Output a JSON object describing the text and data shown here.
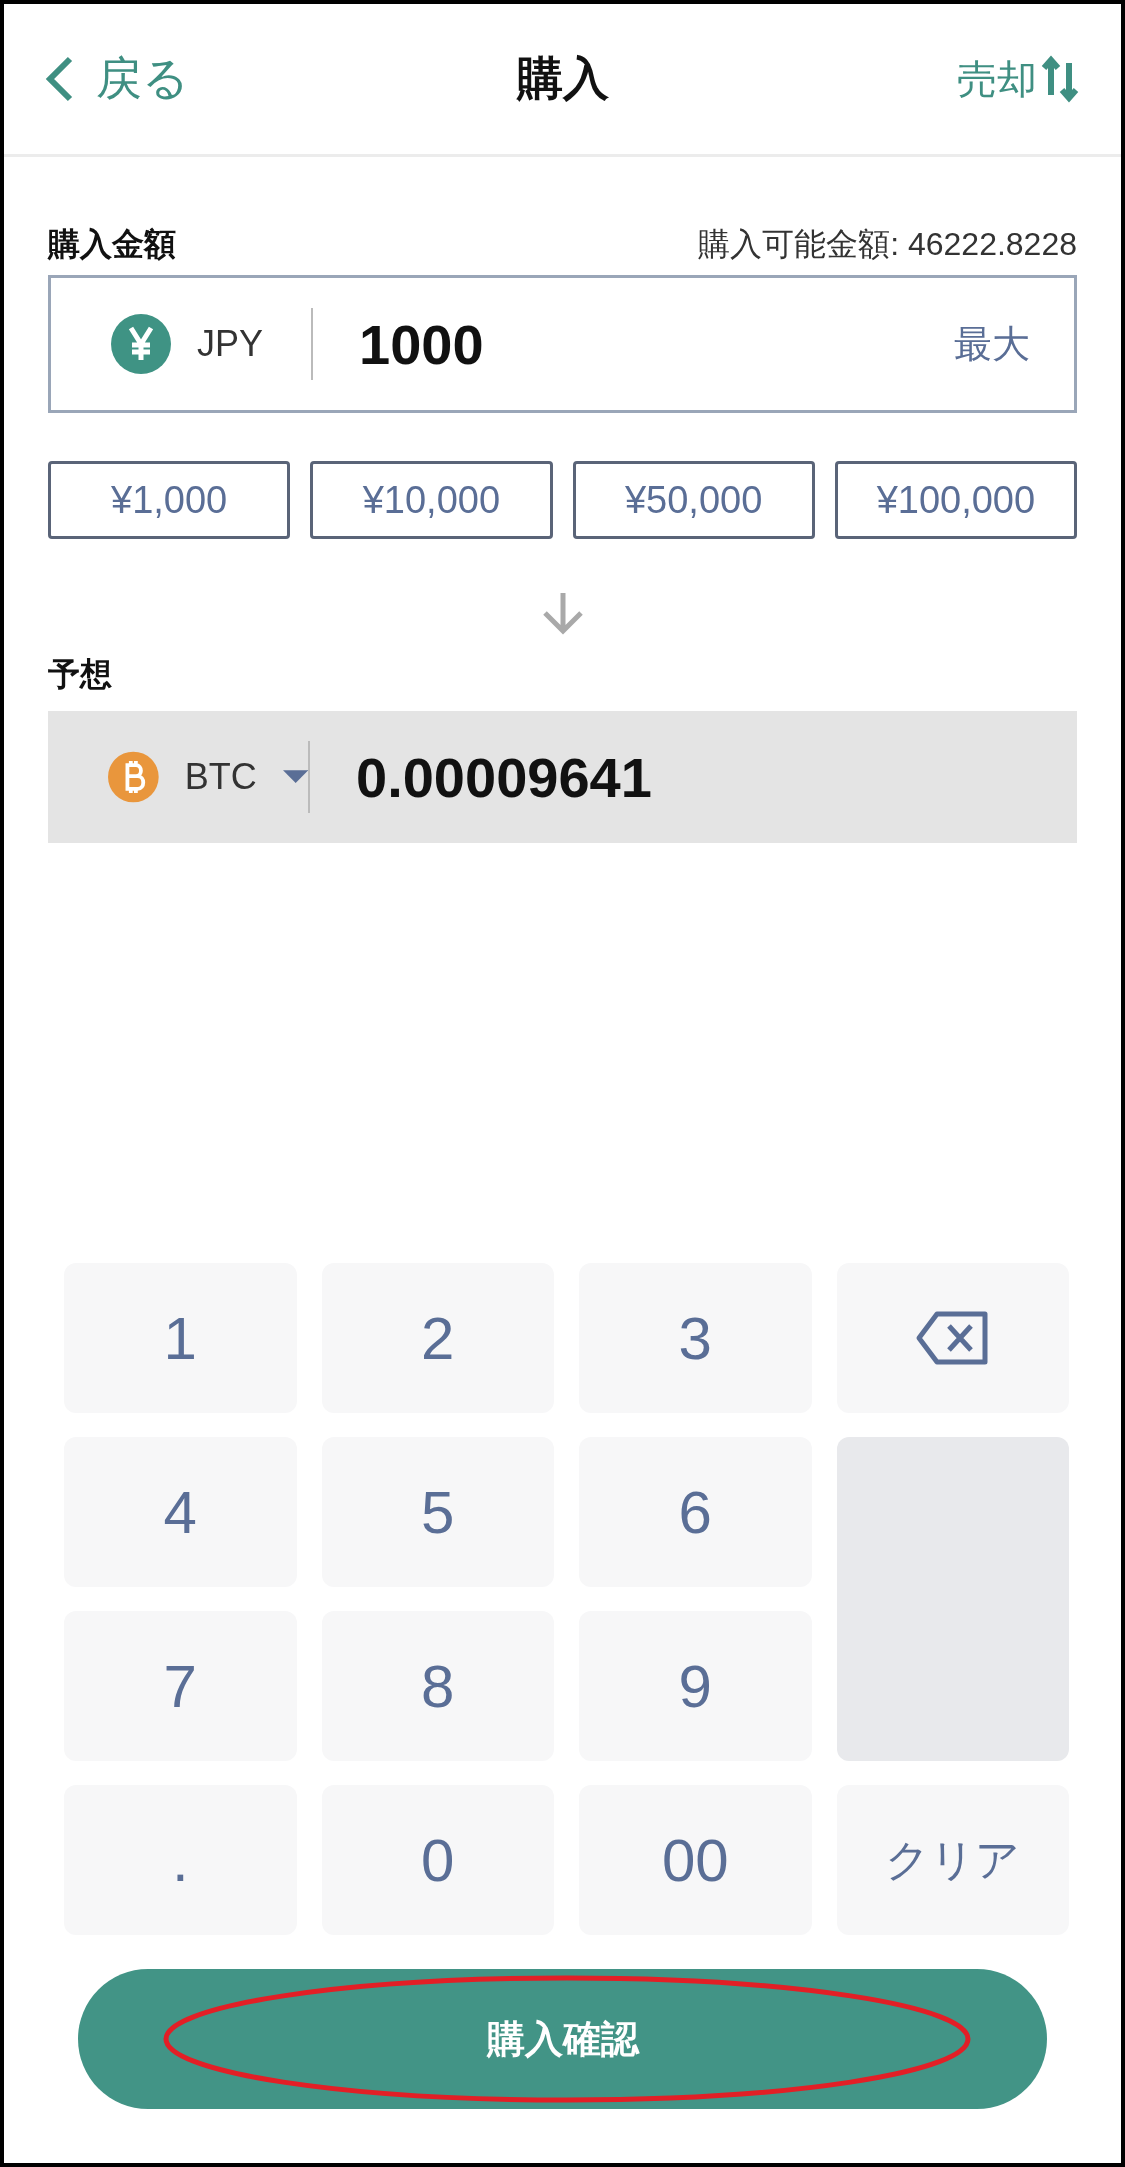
{
  "header": {
    "back": "戻る",
    "title": "購入",
    "switch": "売却"
  },
  "amount": {
    "label": "購入金額",
    "available": "購入可能金額: 46222.8228",
    "currency": "JPY",
    "value": "1000",
    "max": "最大"
  },
  "presets": [
    "¥1,000",
    "¥10,000",
    "¥50,000",
    "¥100,000"
  ],
  "estimate": {
    "label": "予想",
    "currency": "BTC",
    "value": "0.00009641"
  },
  "keypad": [
    {
      "kind": "key",
      "label": "1"
    },
    {
      "kind": "key",
      "label": "2"
    },
    {
      "kind": "key",
      "label": "3"
    },
    {
      "kind": "backspace"
    },
    {
      "kind": "key",
      "label": "4"
    },
    {
      "kind": "key",
      "label": "5"
    },
    {
      "kind": "key",
      "label": "6"
    },
    {
      "kind": "blank"
    },
    {
      "kind": "key",
      "label": "7"
    },
    {
      "kind": "key",
      "label": "8"
    },
    {
      "kind": "key",
      "label": "9"
    },
    {
      "kind": "key",
      "label": "."
    },
    {
      "kind": "key",
      "label": "0"
    },
    {
      "kind": "key",
      "label": "00"
    },
    {
      "kind": "text",
      "label": "クリア"
    }
  ],
  "confirm": {
    "label": "購入確認",
    "highlight": {
      "kind": "ellipse"
    }
  }
}
